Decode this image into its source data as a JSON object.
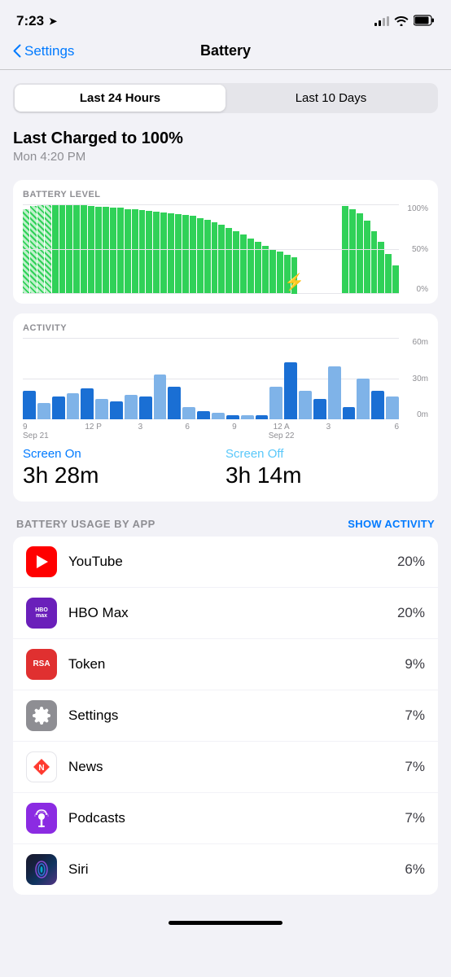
{
  "statusBar": {
    "time": "7:23",
    "locationIcon": "➤"
  },
  "navBar": {
    "backLabel": "Settings",
    "title": "Battery"
  },
  "segmentControl": {
    "option1": "Last 24 Hours",
    "option2": "Last 10 Days",
    "activeIndex": 0
  },
  "lastCharged": {
    "title": "Last Charged to 100%",
    "subtitle": "Mon 4:20 PM"
  },
  "batteryChart": {
    "label": "BATTERY LEVEL",
    "yLabels": [
      "100%",
      "50%",
      "0%"
    ]
  },
  "activityChart": {
    "label": "ACTIVITY",
    "yLabels": [
      "60m",
      "30m",
      "0m"
    ],
    "xLabels": [
      {
        "time": "9",
        "date": "Sep 21"
      },
      {
        "time": "12 P",
        "date": ""
      },
      {
        "time": "3",
        "date": ""
      },
      {
        "time": "6",
        "date": ""
      },
      {
        "time": "9",
        "date": ""
      },
      {
        "time": "12 A",
        "date": "Sep 22"
      },
      {
        "time": "3",
        "date": ""
      },
      {
        "time": "6",
        "date": ""
      }
    ]
  },
  "screenStats": {
    "screenOn": {
      "label": "Screen On",
      "value": "3h 28m"
    },
    "screenOff": {
      "label": "Screen Off",
      "value": "3h 14m"
    }
  },
  "batteryUsage": {
    "sectionLabel": "BATTERY USAGE BY APP",
    "actionLabel": "SHOW ACTIVITY",
    "apps": [
      {
        "name": "YouTube",
        "percent": "20%",
        "iconType": "youtube"
      },
      {
        "name": "HBO Max",
        "percent": "20%",
        "iconType": "hbo"
      },
      {
        "name": "Token",
        "percent": "9%",
        "iconType": "token"
      },
      {
        "name": "Settings",
        "percent": "7%",
        "iconType": "settings"
      },
      {
        "name": "News",
        "percent": "7%",
        "iconType": "news"
      },
      {
        "name": "Podcasts",
        "percent": "7%",
        "iconType": "podcasts"
      },
      {
        "name": "Siri",
        "percent": "6%",
        "iconType": "siri"
      }
    ]
  }
}
